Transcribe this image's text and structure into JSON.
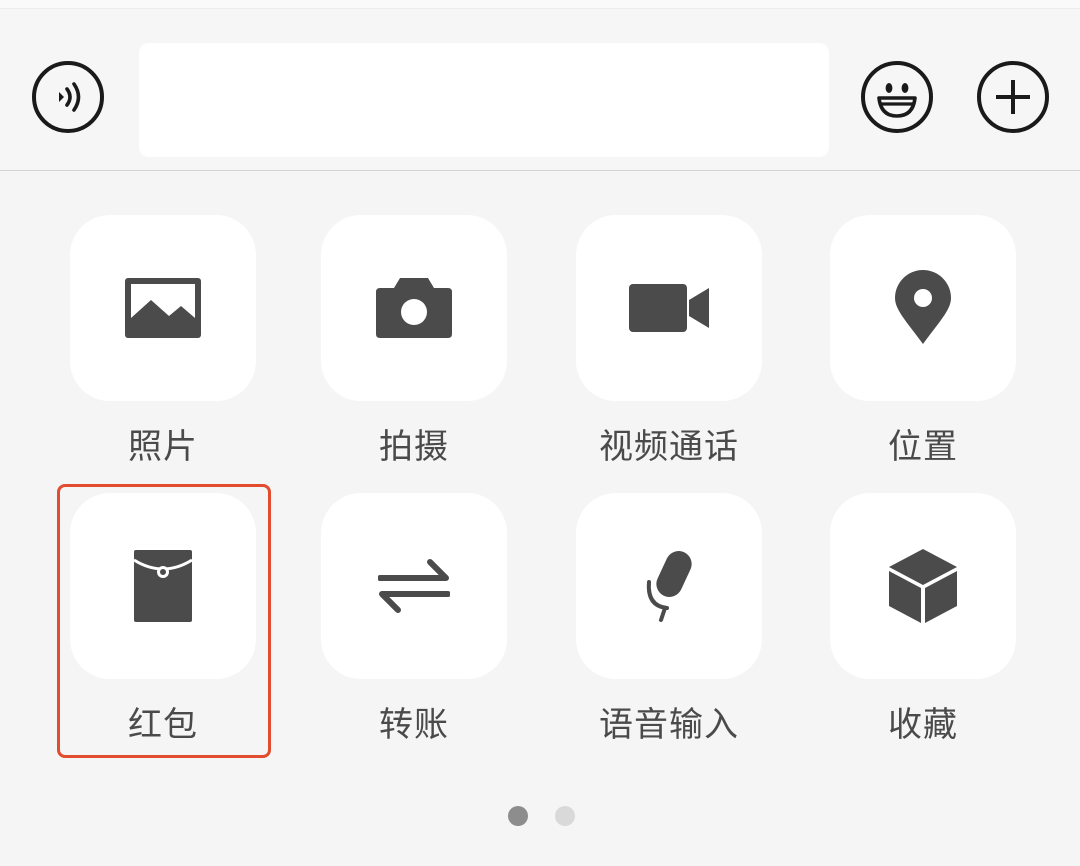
{
  "input_bar": {
    "text_value": "",
    "icons": {
      "voice": "voice-input-icon",
      "emoji": "emoji-icon",
      "more": "plus-icon"
    }
  },
  "actions": [
    {
      "label": "照片",
      "icon": "photo-icon"
    },
    {
      "label": "拍摄",
      "icon": "camera-icon"
    },
    {
      "label": "视频通话",
      "icon": "video-call-icon"
    },
    {
      "label": "位置",
      "icon": "location-pin-icon"
    },
    {
      "label": "红包",
      "icon": "red-packet-icon"
    },
    {
      "label": "转账",
      "icon": "transfer-arrows-icon"
    },
    {
      "label": "语音输入",
      "icon": "microphone-icon"
    },
    {
      "label": "收藏",
      "icon": "favorites-cube-icon"
    }
  ],
  "pagination": {
    "pages": 2,
    "current": 1
  },
  "colors": {
    "background": "#f5f5f5",
    "tile": "#ffffff",
    "icon": "#4b4b4b",
    "label": "#4a4a4a",
    "highlight": "#e24c2f"
  }
}
